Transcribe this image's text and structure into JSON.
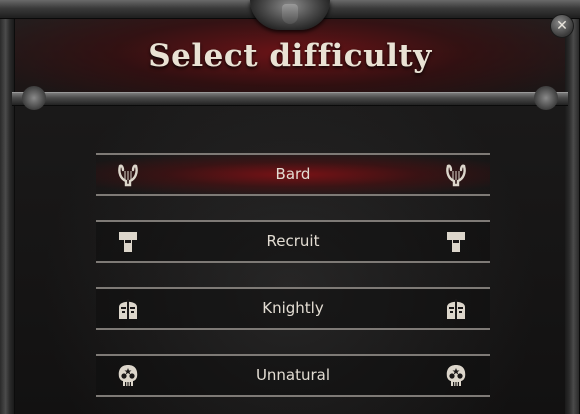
{
  "window": {
    "title": "Select difficulty",
    "close_label": "✕"
  },
  "options": [
    {
      "label": "Bard",
      "icon": "lyre-icon",
      "selected": true
    },
    {
      "label": "Recruit",
      "icon": "helmet-recruit-icon",
      "selected": false
    },
    {
      "label": "Knightly",
      "icon": "helmet-knight-icon",
      "selected": false
    },
    {
      "label": "Unnatural",
      "icon": "skull-icon",
      "selected": false
    }
  ],
  "colors": {
    "selected_accent": "#8a1014",
    "text": "#e3ddd3",
    "rule": "#7e7a76"
  }
}
